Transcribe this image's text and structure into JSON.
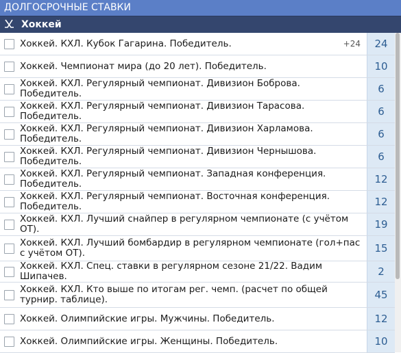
{
  "header": {
    "title": "ДОЛГОСРОЧНЫЕ СТАВКИ",
    "sport": "Хоккей",
    "sport_icon": "hockey-sticks-icon"
  },
  "colors": {
    "title_bg": "#5b7fc7",
    "sport_bg": "#34466e",
    "count_bg": "#dde9f5",
    "count_text": "#2c5d92"
  },
  "events": [
    {
      "label": "Хоккей. КХЛ. Кубок Гагарина. Победитель.",
      "extra": "+24",
      "count": "24"
    },
    {
      "label": "Хоккей. Чемпионат мира (до 20 лет). Победитель.",
      "extra": "",
      "count": "10"
    },
    {
      "label": "Хоккей. КХЛ. Регулярный чемпионат. Дивизион Боброва. Победитель.",
      "extra": "",
      "count": "6"
    },
    {
      "label": "Хоккей. КХЛ. Регулярный чемпионат. Дивизион Тарасова. Победитель.",
      "extra": "",
      "count": "6"
    },
    {
      "label": "Хоккей. КХЛ. Регулярный чемпионат. Дивизион Харламова. Победитель.",
      "extra": "",
      "count": "6"
    },
    {
      "label": "Хоккей. КХЛ. Регулярный чемпионат. Дивизион Чернышова. Победитель.",
      "extra": "",
      "count": "6"
    },
    {
      "label": "Хоккей. КХЛ. Регулярный чемпионат. Западная конференция. Победитель.",
      "extra": "",
      "count": "12"
    },
    {
      "label": "Хоккей. КХЛ. Регулярный чемпионат. Восточная конференция. Победитель.",
      "extra": "",
      "count": "12"
    },
    {
      "label": "Хоккей. КХЛ. Лучший снайпер в регулярном чемпионате (с учётом ОТ).",
      "extra": "",
      "count": "19"
    },
    {
      "label": "Хоккей. КХЛ. Лучший бомбардир в регулярном чемпионате (гол+пас с учётом ОТ).",
      "extra": "",
      "count": "15"
    },
    {
      "label": "Хоккей. КХЛ. Спец. ставки в регулярном сезоне 21/22. Вадим Шипачев.",
      "extra": "",
      "count": "2"
    },
    {
      "label": "Хоккей. КХЛ. Кто выше по итогам рег. чемп. (расчет по общей турнир. таблице).",
      "extra": "",
      "count": "45"
    },
    {
      "label": "Хоккей. Олимпийские игры. Мужчины. Победитель.",
      "extra": "",
      "count": "12"
    },
    {
      "label": "Хоккей. Олимпийские игры. Женщины. Победитель.",
      "extra": "",
      "count": "10"
    }
  ]
}
